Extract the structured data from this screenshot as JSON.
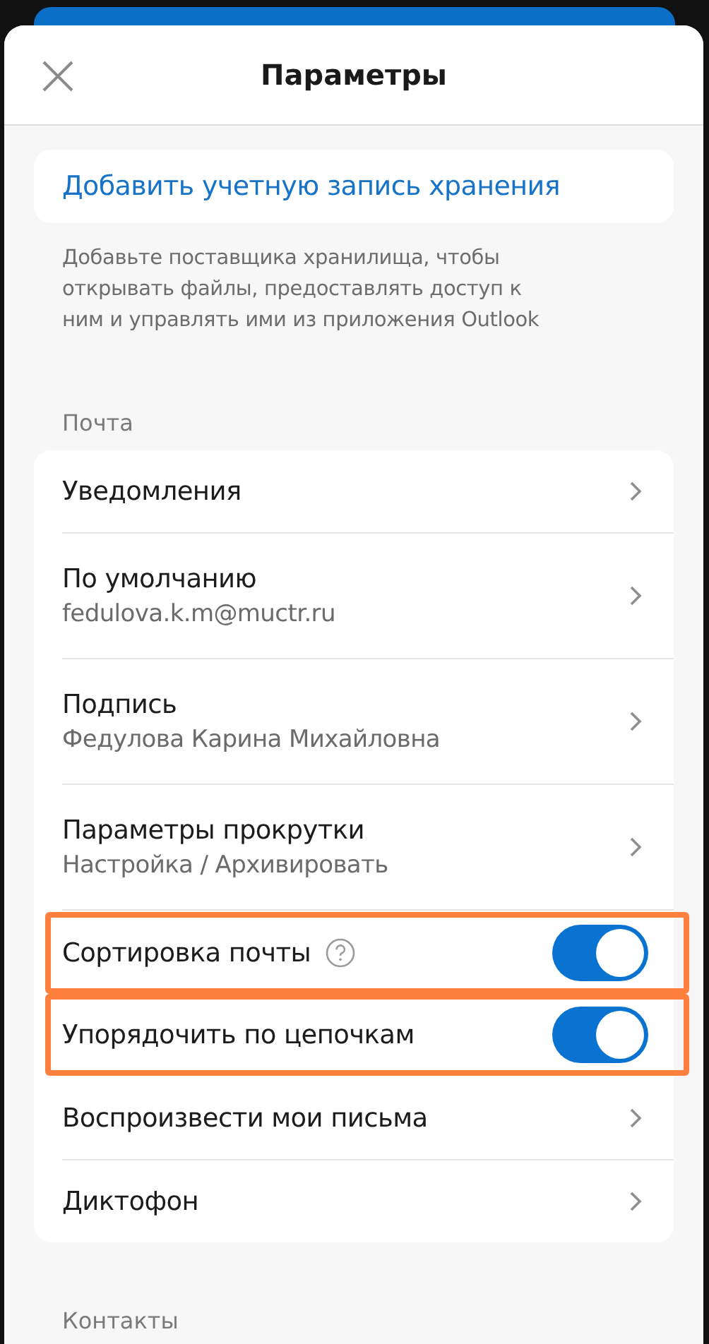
{
  "header": {
    "title": "Параметры"
  },
  "storage": {
    "add_link": "Добавить учетную запись хранения",
    "description": "Добавьте поставщика хранилища, чтобы открывать файлы, предоставлять доступ к ним и управлять ими из приложения Outlook"
  },
  "mail": {
    "heading": "Почта",
    "rows": [
      {
        "kind": "nav",
        "label": "Уведомления"
      },
      {
        "kind": "nav",
        "label": "По умолчанию",
        "value": "fedulova.k.m@muctr.ru"
      },
      {
        "kind": "nav",
        "label": "Подпись",
        "value": "Федулова Карина Михайловна"
      },
      {
        "kind": "nav",
        "label": "Параметры прокрутки",
        "value": "Настройка / Архивировать"
      },
      {
        "kind": "toggle",
        "label": "Сортировка почты",
        "help": true,
        "on": true,
        "highlighted": true
      },
      {
        "kind": "toggle",
        "label": "Упорядочить по цепочкам",
        "on": true,
        "highlighted": true
      },
      {
        "kind": "nav",
        "label": "Воспроизвести мои письма"
      },
      {
        "kind": "nav",
        "label": "Диктофон"
      }
    ]
  },
  "contacts": {
    "heading": "Контакты"
  }
}
